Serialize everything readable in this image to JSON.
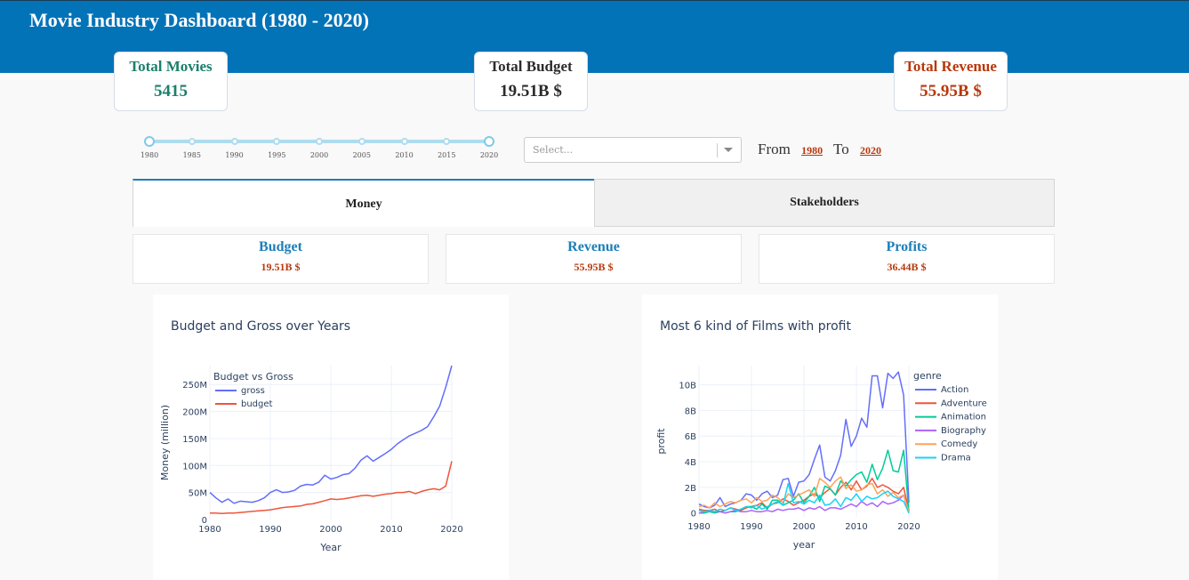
{
  "header": {
    "title": "Movie Industry Dashboard (1980 - 2020)"
  },
  "kpis": {
    "movies": {
      "label": "Total Movies",
      "value": "5415"
    },
    "budget": {
      "label": "Total Budget",
      "value": "19.51B $"
    },
    "revenue": {
      "label": "Total Revenue",
      "value": "55.95B $"
    }
  },
  "slider": {
    "marks": [
      "1980",
      "1985",
      "1990",
      "1995",
      "2000",
      "2005",
      "2010",
      "2015",
      "2020"
    ],
    "min": 1980,
    "max": 2020,
    "selected": [
      1980,
      2020
    ]
  },
  "filter": {
    "placeholder": "Select..."
  },
  "range": {
    "from_label": "From",
    "to_label": "To",
    "from": "1980",
    "to": "2020"
  },
  "tabs": {
    "money": "Money",
    "stakeholders": "Stakeholders",
    "active": "money"
  },
  "money_cards": {
    "budget": {
      "label": "Budget",
      "value": "19.51B $"
    },
    "revenue": {
      "label": "Revenue",
      "value": "55.95B $"
    },
    "profits": {
      "label": "Profits",
      "value": "36.44B $"
    }
  },
  "colors": {
    "header": "#0373b8",
    "accent_red": "#b8380d",
    "accent_teal": "#1b7f6d",
    "accent_blue": "#1b7fb8"
  },
  "chart_data": [
    {
      "type": "line",
      "title": "Budget and Gross over Years",
      "xlabel": "Year",
      "ylabel": "Money (million)",
      "legend_title": "Budget vs Gross",
      "legend_position": "top-left",
      "xlim": [
        1980,
        2020
      ],
      "ylim": [
        0,
        285
      ],
      "x_ticks": [
        "1980",
        "1990",
        "2000",
        "2010",
        "2020"
      ],
      "y_ticks": [
        {
          "v": 0,
          "label": "0"
        },
        {
          "v": 50,
          "label": "50M"
        },
        {
          "v": 100,
          "label": "100M"
        },
        {
          "v": 150,
          "label": "150M"
        },
        {
          "v": 200,
          "label": "200M"
        },
        {
          "v": 250,
          "label": "250M"
        }
      ],
      "x": [
        1980,
        1981,
        1982,
        1983,
        1984,
        1985,
        1986,
        1987,
        1988,
        1989,
        1990,
        1991,
        1992,
        1993,
        1994,
        1995,
        1996,
        1997,
        1998,
        1999,
        2000,
        2001,
        2002,
        2003,
        2004,
        2005,
        2006,
        2007,
        2008,
        2009,
        2010,
        2011,
        2012,
        2013,
        2014,
        2015,
        2016,
        2017,
        2018,
        2019,
        2020
      ],
      "series": [
        {
          "name": "gross",
          "color": "#636efa",
          "values": [
            50,
            40,
            32,
            38,
            30,
            34,
            33,
            32,
            35,
            40,
            50,
            55,
            50,
            51,
            54,
            62,
            65,
            64,
            69,
            82,
            75,
            78,
            83,
            85,
            95,
            110,
            118,
            108,
            115,
            122,
            130,
            140,
            148,
            155,
            160,
            165,
            172,
            190,
            210,
            245,
            285
          ]
        },
        {
          "name": "budget",
          "color": "#ef553b",
          "values": [
            12,
            12,
            11,
            12,
            12,
            13,
            14,
            15,
            16,
            17,
            18,
            20,
            22,
            23,
            24,
            25,
            28,
            29,
            32,
            35,
            38,
            37,
            38,
            40,
            42,
            44,
            45,
            43,
            45,
            47,
            48,
            50,
            50,
            52,
            48,
            52,
            55,
            57,
            55,
            62,
            108
          ]
        }
      ]
    },
    {
      "type": "line",
      "title": "Most 6 kind of Films with profit",
      "xlabel": "year",
      "ylabel": "profit",
      "legend_title": "genre",
      "legend_position": "top-right",
      "xlim": [
        1980,
        2020
      ],
      "ylim": [
        -0.3,
        11.5
      ],
      "x_ticks": [
        "1980",
        "1990",
        "2000",
        "2010",
        "2020"
      ],
      "y_ticks": [
        {
          "v": 0,
          "label": "0"
        },
        {
          "v": 2,
          "label": "2B"
        },
        {
          "v": 4,
          "label": "4B"
        },
        {
          "v": 6,
          "label": "6B"
        },
        {
          "v": 8,
          "label": "8B"
        },
        {
          "v": 10,
          "label": "10B"
        }
      ],
      "x": [
        1980,
        1981,
        1982,
        1983,
        1984,
        1985,
        1986,
        1987,
        1988,
        1989,
        1990,
        1991,
        1992,
        1993,
        1994,
        1995,
        1996,
        1997,
        1998,
        1999,
        2000,
        2001,
        2002,
        2003,
        2004,
        2005,
        2006,
        2007,
        2008,
        2009,
        2010,
        2011,
        2012,
        2013,
        2014,
        2015,
        2016,
        2017,
        2018,
        2019,
        2020
      ],
      "series": [
        {
          "name": "Action",
          "color": "#636efa",
          "values": [
            0.7,
            0.5,
            0.4,
            0.6,
            1.2,
            0.5,
            0.7,
            0.8,
            1.0,
            1.5,
            1.4,
            1.0,
            1.5,
            1.7,
            1.2,
            1.4,
            2.6,
            2.7,
            1.3,
            2.4,
            2.5,
            3.0,
            4.2,
            5.3,
            2.8,
            2.5,
            3.3,
            4.5,
            7.3,
            5.2,
            6.0,
            7.4,
            6.7,
            10.7,
            10.7,
            8.2,
            10.9,
            10.5,
            11.0,
            9.2,
            0.8
          ]
        },
        {
          "name": "Adventure",
          "color": "#ef553b",
          "values": [
            0.3,
            0.2,
            0.2,
            0.3,
            0.1,
            0.2,
            0.4,
            0.3,
            0.2,
            0.4,
            0.5,
            0.6,
            0.8,
            0.4,
            0.7,
            0.8,
            1.1,
            0.9,
            0.6,
            0.8,
            1.0,
            1.3,
            1.5,
            1.2,
            1.6,
            1.9,
            1.4,
            2.0,
            2.4,
            1.8,
            2.5,
            1.8,
            2.1,
            2.7,
            2.0,
            2.2,
            2.0,
            1.7,
            1.5,
            2.0,
            0.2
          ]
        },
        {
          "name": "Animation",
          "color": "#00cc96",
          "values": [
            0.0,
            0.0,
            0.1,
            0.0,
            0.1,
            0.0,
            0.1,
            0.1,
            0.3,
            0.5,
            0.5,
            0.3,
            0.7,
            0.3,
            1.0,
            1.0,
            0.6,
            0.8,
            1.0,
            1.5,
            0.8,
            1.3,
            2.0,
            0.9,
            2.1,
            1.9,
            1.4,
            2.5,
            2.1,
            2.6,
            3.0,
            3.2,
            2.4,
            3.8,
            2.6,
            3.5,
            4.9,
            3.3,
            3.2,
            4.9,
            0.1
          ]
        },
        {
          "name": "Biography",
          "color": "#ab63fa",
          "values": [
            0.0,
            0.1,
            0.2,
            0.1,
            0.1,
            0.0,
            0.1,
            0.2,
            0.1,
            0.1,
            0.2,
            0.1,
            0.1,
            0.2,
            0.1,
            0.3,
            0.2,
            0.3,
            0.3,
            0.4,
            0.2,
            0.4,
            0.3,
            0.5,
            0.2,
            0.4,
            0.4,
            0.3,
            0.5,
            0.7,
            0.5,
            0.9,
            0.6,
            0.8,
            0.5,
            0.9,
            0.7,
            0.8,
            1.0,
            1.4,
            0.0
          ]
        },
        {
          "name": "Comedy",
          "color": "#ffa15a",
          "values": [
            0.5,
            0.6,
            0.4,
            0.8,
            0.5,
            0.7,
            0.9,
            0.8,
            1.0,
            1.1,
            0.8,
            1.2,
            0.9,
            1.0,
            1.4,
            1.2,
            0.8,
            1.5,
            1.2,
            1.4,
            1.6,
            1.8,
            1.3,
            2.7,
            2.4,
            2.0,
            2.5,
            2.8,
            1.9,
            2.2,
            1.7,
            1.8,
            2.2,
            2.3,
            1.5,
            1.8,
            1.3,
            1.6,
            1.2,
            1.4,
            0.1
          ]
        },
        {
          "name": "Drama",
          "color": "#19d3f3",
          "values": [
            0.2,
            0.1,
            0.2,
            0.1,
            0.3,
            0.2,
            0.4,
            0.2,
            0.3,
            0.5,
            0.4,
            0.6,
            0.3,
            0.5,
            0.7,
            0.9,
            0.6,
            2.3,
            0.8,
            0.9,
            0.7,
            1.0,
            0.8,
            1.4,
            0.6,
            0.7,
            1.1,
            0.5,
            1.2,
            1.0,
            1.5,
            0.9,
            1.3,
            1.1,
            1.2,
            1.5,
            1.7,
            1.3,
            1.1,
            0.9,
            0.0
          ]
        }
      ]
    }
  ]
}
